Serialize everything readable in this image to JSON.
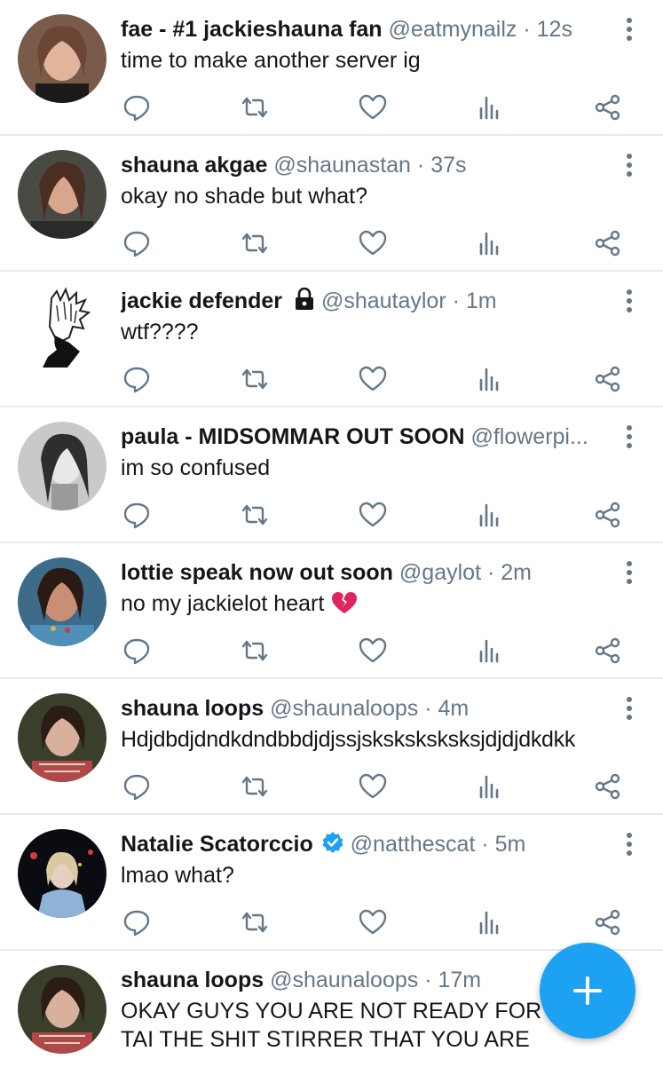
{
  "colors": {
    "accent": "#1da1f2",
    "text": "#14171a",
    "meta": "#657786",
    "divider": "#e6ecf0",
    "heart_emoji": "#e0245e"
  },
  "tweets": [
    {
      "name": "fae - #1 jackieshauna fan",
      "handle": "@eatmynailz",
      "time": "12s",
      "text": "time to make another server ig"
    },
    {
      "name": "shauna akgae",
      "handle": "@shaunastan",
      "time": "37s",
      "text": "okay no shade but what?"
    },
    {
      "name": "jackie defender",
      "handle": "@shautaylor",
      "time": "1m",
      "text": "wtf????",
      "locked": true
    },
    {
      "name": "paula - MIDSOMMAR OUT SOON",
      "handle": "@flowerpi...",
      "time": "",
      "text": "im so confused"
    },
    {
      "name": "lottie speak now out soon",
      "handle": "@gaylot",
      "time": "2m",
      "text": "no my jackielot heart",
      "emoji": "broken-heart-icon"
    },
    {
      "name": "shauna loops",
      "handle": "@shaunaloops",
      "time": "4m",
      "text": "Hdjdbdjdndkdndbbdjdjssjsksksksksksjdjdjdkdkk"
    },
    {
      "name": "Natalie Scatorccio",
      "handle": "@natthescat",
      "time": "5m",
      "text": "lmao what?",
      "verified": true
    },
    {
      "name": "shauna loops",
      "handle": "@shaunaloops",
      "time": "17m",
      "text": "OKAY GUYS YOU ARE NOT READY FOR",
      "text2": "TAI THE SHIT STIRRER THAT YOU ARE"
    }
  ],
  "fab": {
    "icon": "plus-icon",
    "label": "+"
  }
}
